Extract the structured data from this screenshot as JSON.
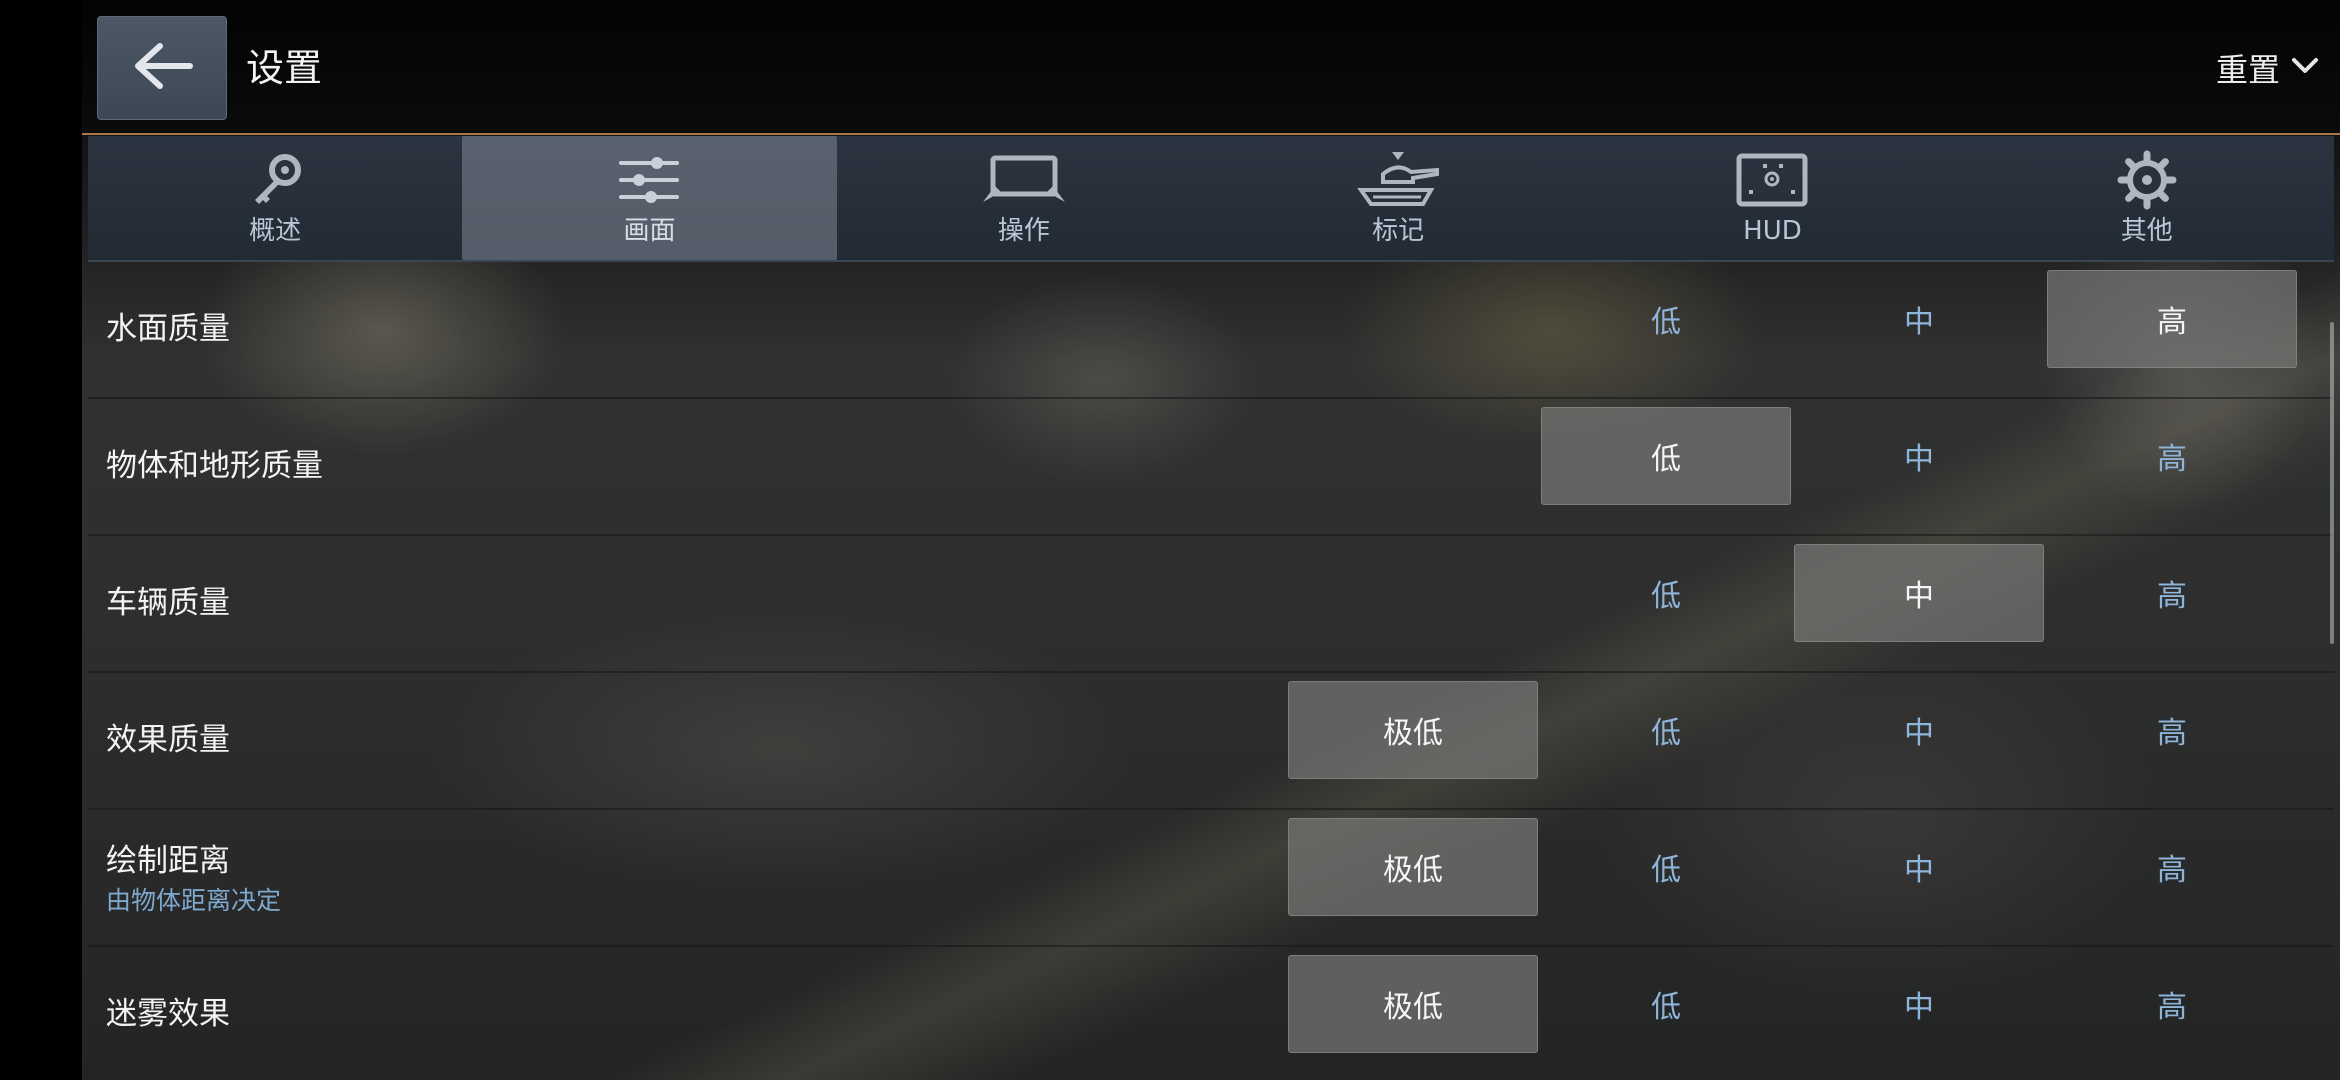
{
  "header": {
    "back_icon": "arrow-left-icon",
    "title": "设置",
    "reset_label": "重置",
    "reset_icon": "chevron-down-icon"
  },
  "tabs": [
    {
      "label": "概述",
      "icon": "key-icon",
      "active": false
    },
    {
      "label": "画面",
      "icon": "sliders-icon",
      "active": true
    },
    {
      "label": "操作",
      "icon": "controls-icon",
      "active": false
    },
    {
      "label": "标记",
      "icon": "tank-marker-icon",
      "active": false
    },
    {
      "label": "HUD",
      "icon": "hud-screen-icon",
      "active": false
    },
    {
      "label": "其他",
      "icon": "gear-icon",
      "active": false
    }
  ],
  "settings": [
    {
      "title": "水面质量",
      "subtitle": "",
      "options": [
        "低",
        "中",
        "高"
      ],
      "selected": "高"
    },
    {
      "title": "物体和地形质量",
      "subtitle": "",
      "options": [
        "低",
        "中",
        "高"
      ],
      "selected": "低"
    },
    {
      "title": "车辆质量",
      "subtitle": "",
      "options": [
        "低",
        "中",
        "高"
      ],
      "selected": "中"
    },
    {
      "title": "效果质量",
      "subtitle": "",
      "options": [
        "极低",
        "低",
        "中",
        "高"
      ],
      "selected": "极低"
    },
    {
      "title": "绘制距离",
      "subtitle": "由物体距离决定",
      "options": [
        "极低",
        "低",
        "中",
        "高"
      ],
      "selected": "极低"
    },
    {
      "title": "迷雾效果",
      "subtitle": "",
      "options": [
        "极低",
        "低",
        "中",
        "高"
      ],
      "selected": "极低"
    }
  ],
  "colors": {
    "accent_line": "#a9784a",
    "option_text": "#8fb4da",
    "subtitle_text": "#7fa8cf"
  }
}
